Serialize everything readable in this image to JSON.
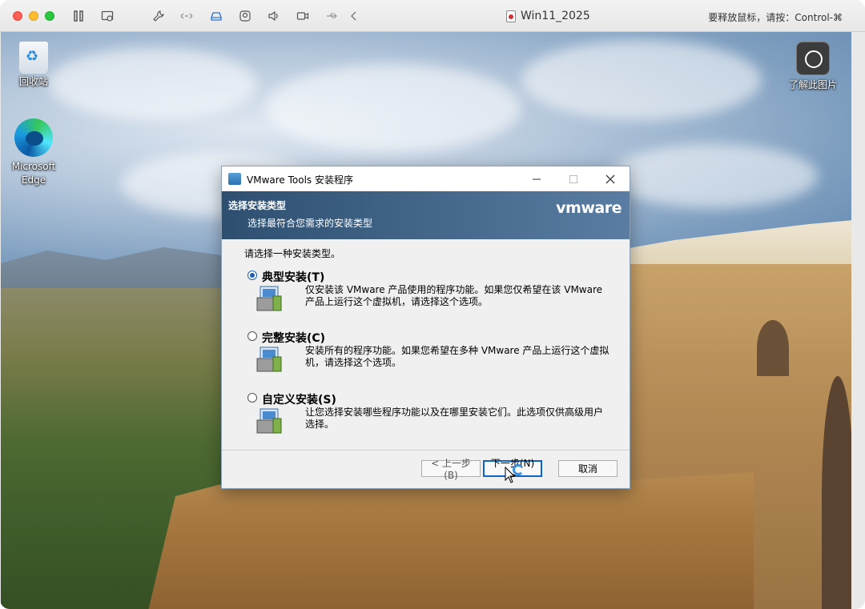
{
  "mac": {
    "window_title": "Win11_2025",
    "release_hint": "要释放鼠标，请按：Control-⌘"
  },
  "desktop": {
    "icons": [
      {
        "label": "回收站"
      },
      {
        "label": "Microsoft Edge"
      },
      {
        "label": "了解此图片"
      }
    ]
  },
  "dialog": {
    "title": "VMware Tools 安装程序",
    "banner_title": "选择安装类型",
    "banner_subtitle": "选择最符合您需求的安装类型",
    "logo": "vmware",
    "prompt": "请选择一种安装类型。",
    "options": [
      {
        "label": "典型安装(T)",
        "selected": true,
        "desc": "仅安装该 VMware 产品使用的程序功能。如果您仅希望在该 VMware 产品上运行这个虚拟机，请选择这个选项。"
      },
      {
        "label": "完整安装(C)",
        "selected": false,
        "desc": "安装所有的程序功能。如果您希望在多种 VMware 产品上运行这个虚拟机，请选择这个选项。"
      },
      {
        "label": "自定义安装(S)",
        "selected": false,
        "desc": "让您选择安装哪些程序功能以及在哪里安装它们。此选项仅供高级用户选择。"
      }
    ],
    "buttons": {
      "prev": "< 上一步(B)",
      "next": "下一步(N) >",
      "cancel": "取消"
    }
  },
  "colors": {
    "banner": "#476a8e",
    "accent": "#1a5fb4"
  }
}
